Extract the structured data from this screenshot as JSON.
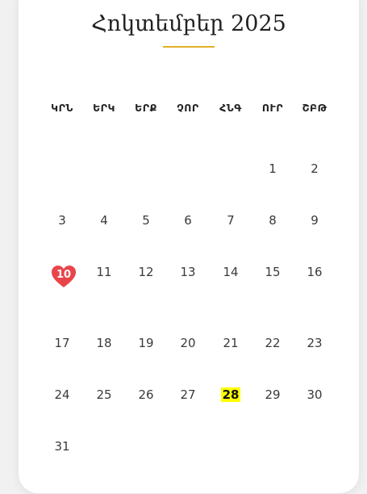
{
  "calendar": {
    "month_title": "Հոկտեմբեր 2025",
    "weekdays": [
      "ԿՐՆ",
      "ԵՐԿ",
      "ԵՐՔ",
      "ՉՈՐ",
      "ՀՆԳ",
      "ՈՒՐ",
      "ՇԲԹ"
    ],
    "days": [
      "1",
      "2",
      "3",
      "4",
      "5",
      "6",
      "7",
      "8",
      "9",
      "10",
      "11",
      "12",
      "13",
      "14",
      "15",
      "16",
      "17",
      "18",
      "19",
      "20",
      "21",
      "22",
      "23",
      "24",
      "25",
      "26",
      "27",
      "28",
      "29",
      "30",
      "31"
    ],
    "heart_day": "10",
    "heart_color": "#e8454b",
    "highlight_day": "28",
    "highlight_color": "#ffff00",
    "accent_color": "#e3b02a",
    "heart_icon": "heart-icon"
  }
}
